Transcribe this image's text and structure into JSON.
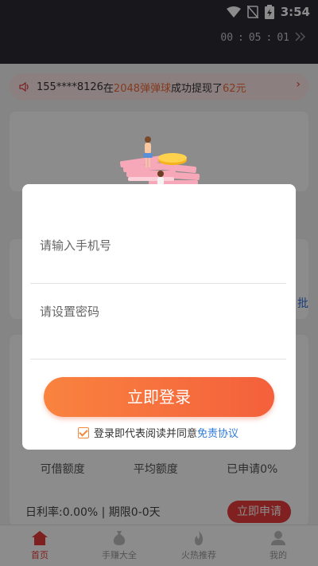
{
  "status_bar": {
    "time": "3:54",
    "icons": [
      "wifi-icon",
      "sim-off-icon",
      "battery-charging-icon"
    ]
  },
  "timer": {
    "hours": "00",
    "minutes": "05",
    "seconds": "01",
    "separator": ":",
    "expand_icon": "double-chevron-right-icon"
  },
  "notice": {
    "user": "155****8126",
    "prefix": "在",
    "game": "2048弹弹球",
    "middle": "成功提现了",
    "amount": "62元"
  },
  "background": {
    "blue_action_fragment": "批",
    "stats": [
      "可借额度",
      "平均额度",
      "已申请0%"
    ],
    "rate_text": "日利率:0.00% | 期限0-0天",
    "apply_label": "立即申请"
  },
  "bottom_nav": [
    {
      "label": "首页",
      "icon": "home-icon",
      "active": true
    },
    {
      "label": "手赚大全",
      "icon": "money-bag-icon",
      "active": false
    },
    {
      "label": "火热推荐",
      "icon": "flame-icon",
      "active": false
    },
    {
      "label": "我的",
      "icon": "user-icon",
      "active": false
    }
  ],
  "login_dialog": {
    "phone_placeholder": "请输入手机号",
    "password_placeholder": "请设置密码",
    "login_label": "立即登录",
    "agree_text": "登录即代表阅读并同意",
    "agree_link": "免责协议",
    "agreed": true
  },
  "colors": {
    "accent": "#f4603c",
    "link": "#2f7bd8",
    "status_bar": "#2b2b33"
  }
}
